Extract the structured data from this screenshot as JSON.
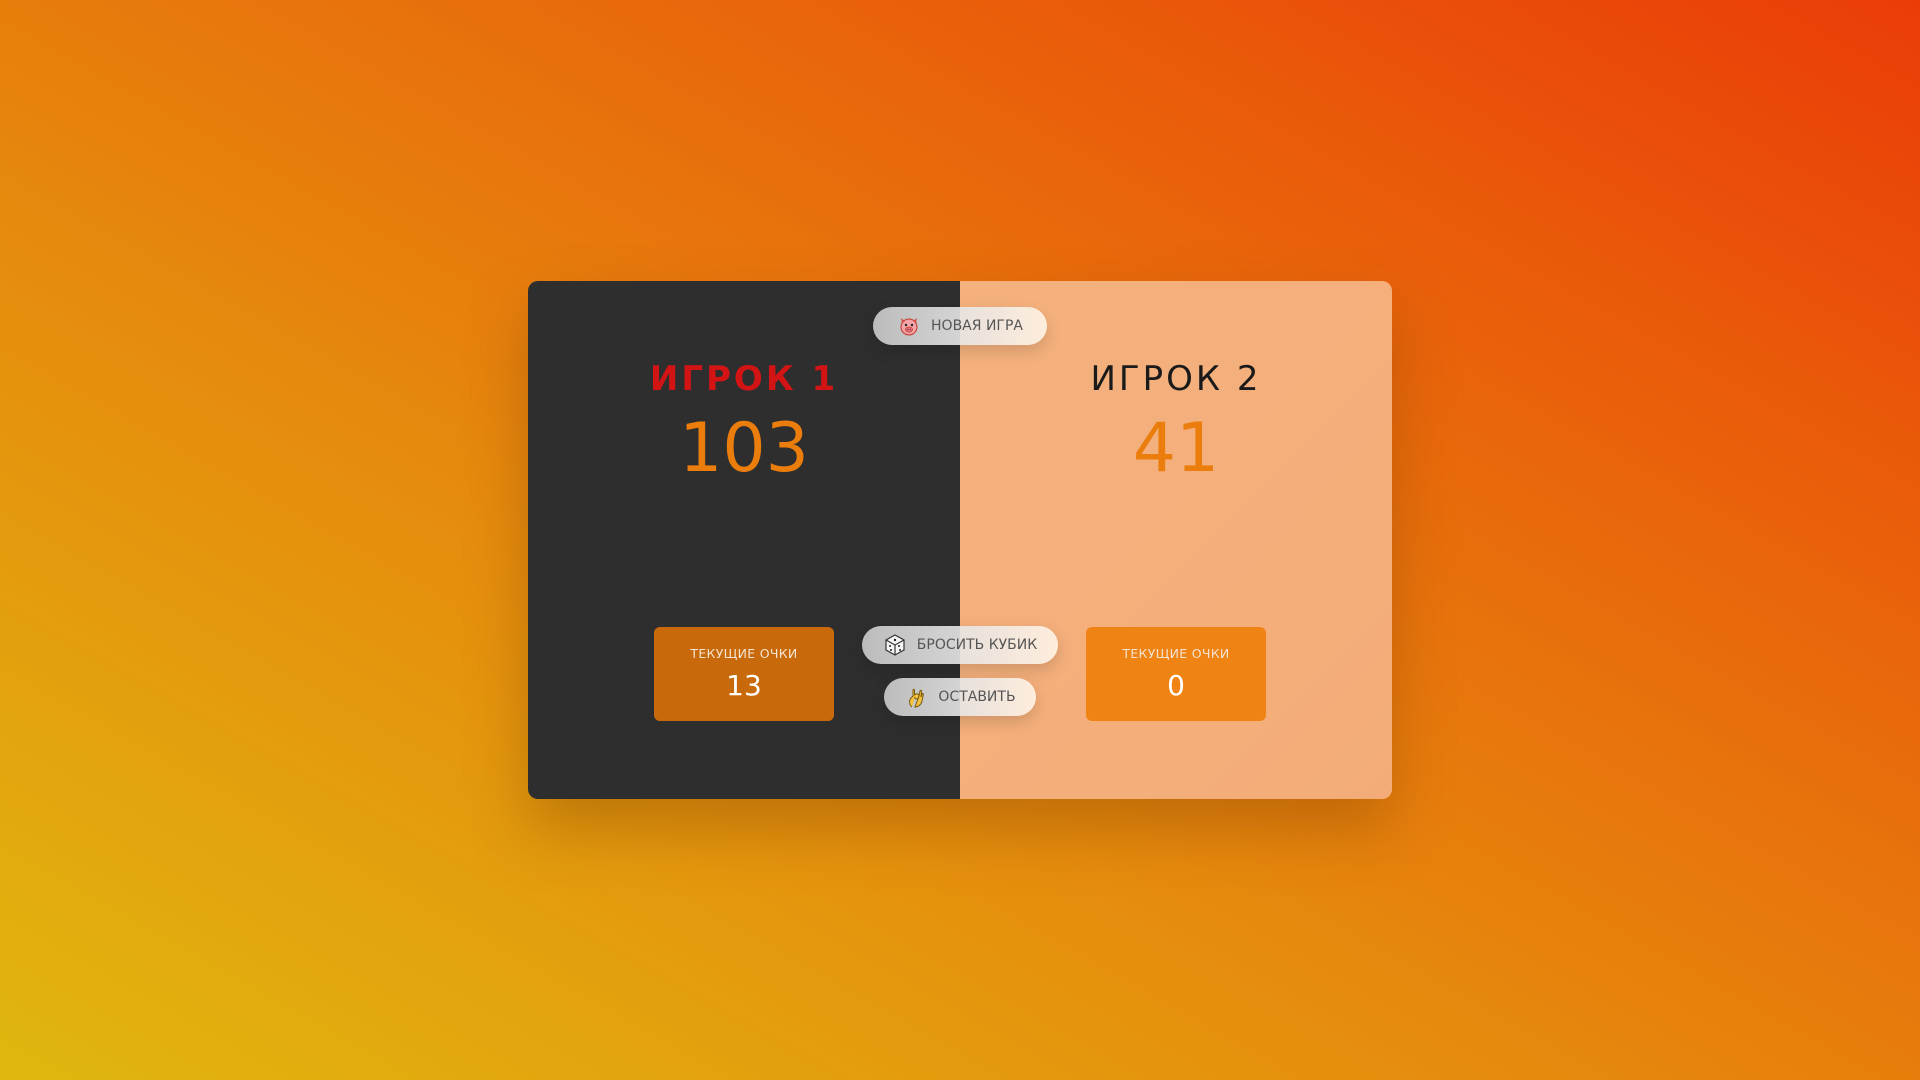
{
  "players": [
    {
      "name": "ИГРОК 1",
      "score": "103",
      "current_label": "ТЕКУЩИЕ ОЧКИ",
      "current_score": "13",
      "active": true
    },
    {
      "name": "ИГРОК 2",
      "score": "41",
      "current_label": "ТЕКУЩИЕ ОЧКИ",
      "current_score": "0",
      "active": false
    }
  ],
  "controls": {
    "new_game": {
      "label": "НОВАЯ ИГРА",
      "icon": "pig-icon"
    },
    "roll_dice": {
      "label": "БРОСИТЬ КУБИК",
      "icon": "dice-icon"
    },
    "hold": {
      "label": "ОСТАВИТЬ",
      "icon": "ok-hand-icon"
    }
  },
  "colors": {
    "active_name": "#d31414",
    "score": "#eb7d0d",
    "panel_dark": "#2e2e2e",
    "panel_light": "#f0a266"
  }
}
